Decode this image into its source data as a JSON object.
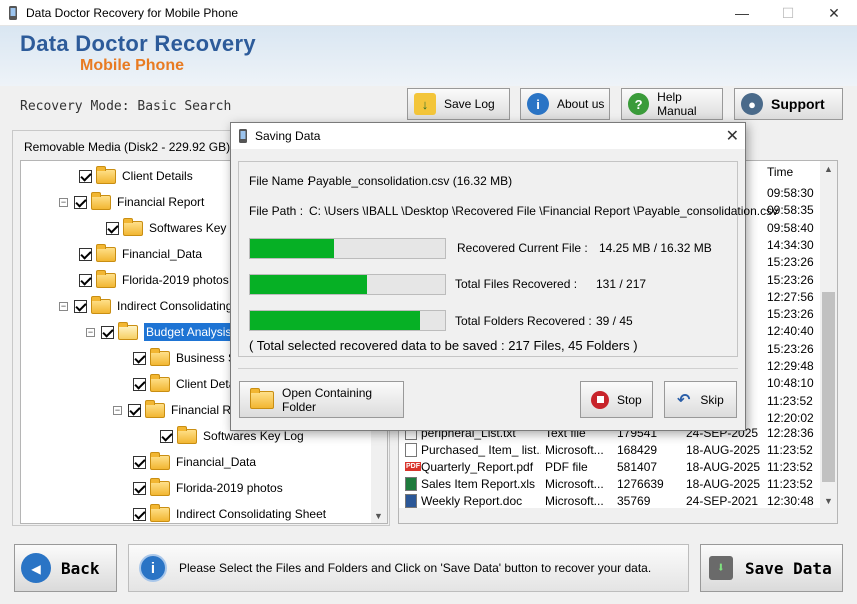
{
  "window": {
    "title": "Data Doctor Recovery for Mobile Phone",
    "minimize_glyph": "—",
    "maximize_glyph": "☐",
    "close_glyph": "✕"
  },
  "header": {
    "brand_title": "Data Doctor Recovery",
    "brand_subtitle": "Mobile Phone"
  },
  "toolbar": {
    "recovery_mode": "Recovery Mode: Basic Search",
    "save_log": "Save Log",
    "about_us": "About us",
    "help_manual": "Help Manual",
    "support": "Support"
  },
  "left_panel": {
    "label": "Removable Media (Disk2 - 229.92 GB)",
    "tree": [
      {
        "label": "Client Details"
      },
      {
        "label": "Financial Report"
      },
      {
        "label": "Softwares Key Log"
      },
      {
        "label": "Financial_Data"
      },
      {
        "label": "Florida-2019 photos"
      },
      {
        "label": "Indirect Consolidating Sheet"
      },
      {
        "label": "Budget Analysis Details"
      },
      {
        "label": "Business Sales"
      },
      {
        "label": "Client Details"
      },
      {
        "label": "Financial Report"
      },
      {
        "label": "Softwares Key Log"
      },
      {
        "label": "Financial_Data"
      },
      {
        "label": "Florida-2019 photos"
      },
      {
        "label": "Indirect Consolidating Sheet"
      }
    ]
  },
  "right_panel": {
    "time_header": "Time",
    "time_column": [
      "09:58:30",
      "09:58:35",
      "09:58:40",
      "14:34:30",
      "15:23:26",
      "15:23:26",
      "12:27:56",
      "15:23:26",
      "12:40:40",
      "15:23:26",
      "12:29:48",
      "10:48:10",
      "11:23:52",
      "12:20:02"
    ],
    "rows": [
      {
        "name": "peripheral_List.txt",
        "type": "Text file",
        "size": "179541",
        "date": "24-SEP-2025",
        "time": "12:28:36",
        "icon": "text-file-icon"
      },
      {
        "name": "Purchased_ Item_ list...",
        "type": "Microsoft...",
        "size": "168429",
        "date": "18-AUG-2025",
        "time": "11:23:52",
        "icon": "text-file-icon"
      },
      {
        "name": "Quarterly_Report.pdf",
        "type": "PDF file",
        "size": "581407",
        "date": "18-AUG-2025",
        "time": "11:23:52",
        "icon": "pdf-file-icon"
      },
      {
        "name": "Sales Item Report.xls",
        "type": "Microsoft...",
        "size": "1276639",
        "date": "18-AUG-2025",
        "time": "11:23:52",
        "icon": "excel-file-icon"
      },
      {
        "name": "Weekly Report.doc",
        "type": "Microsoft...",
        "size": "35769",
        "date": "24-SEP-2021",
        "time": "12:30:48",
        "icon": "word-file-icon"
      }
    ],
    "pdf_badge": "PDF"
  },
  "bottom": {
    "back": "Back",
    "info": "Please Select the Files and Folders and Click on 'Save Data' button to recover your data.",
    "save_data": "Save Data"
  },
  "dialog": {
    "title": "Saving Data",
    "close_glyph": "✕",
    "file_name_label": "File Name :",
    "file_name_value": "Payable_consolidation.csv (16.32 MB)",
    "file_path_label": "File Path :",
    "file_path_value": "C: \\Users \\IBALL \\Desktop \\Recovered File \\Financial Report \\Payable_consolidation.csv",
    "recovered_current_label": "Recovered Current File :",
    "recovered_current_value": "14.25 MB /  16.32 MB",
    "recovered_current_fraction": 0.43,
    "total_files_label": "Total Files Recovered :",
    "total_files_value": "131 / 217",
    "total_files_fraction": 0.6,
    "total_folders_label": "Total Folders Recovered :",
    "total_folders_value": "39 / 45",
    "total_folders_fraction": 0.87,
    "summary": "( Total selected recovered data to be saved : 217 Files, 45 Folders )",
    "open_folder": "Open Containing Folder",
    "stop": "Stop",
    "skip": "Skip"
  },
  "colors": {
    "brand_blue": "#2d5b9a",
    "brand_orange": "#e87b22",
    "progress_green": "#06b025",
    "selection_blue": "#1e74d4"
  }
}
